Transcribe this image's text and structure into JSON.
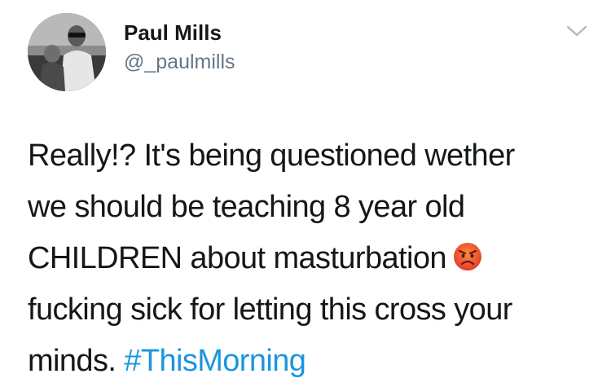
{
  "user": {
    "display_name": "Paul Mills",
    "handle": "@_paulmills",
    "avatar_icon": "avatar-photo"
  },
  "menu": {
    "icon": "chevron-down-icon"
  },
  "tweet": {
    "lines": [
      "Really!? It's being questioned wether",
      "we should be teaching 8 year old",
      "CHILDREN about masturbation",
      "fucking sick for letting this cross your",
      "minds."
    ],
    "emoji": "angry-face-emoji",
    "hashtag": "#ThisMorning"
  },
  "colors": {
    "text": "#14171a",
    "secondary": "#657786",
    "link": "#1b95e0",
    "emoji_red": "#e8492a"
  }
}
